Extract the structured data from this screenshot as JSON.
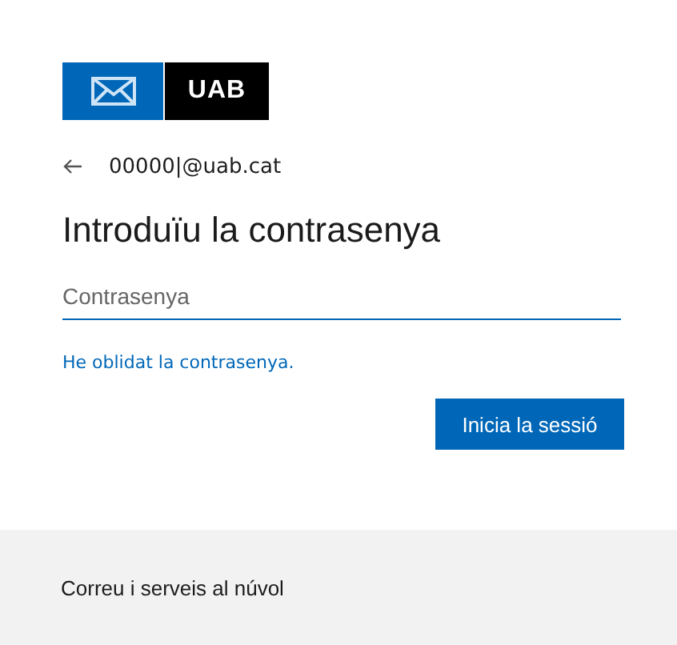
{
  "logo": {
    "text": "UAB"
  },
  "account": {
    "email": "00000|@uab.cat"
  },
  "title": "Introduïu la contrasenya",
  "password": {
    "placeholder": "Contrasenya"
  },
  "forgot_link": "He oblidat la contrasenya.",
  "sign_in_button": "Inicia la sessió",
  "footer": {
    "text": "Correu i serveis al núvol"
  }
}
